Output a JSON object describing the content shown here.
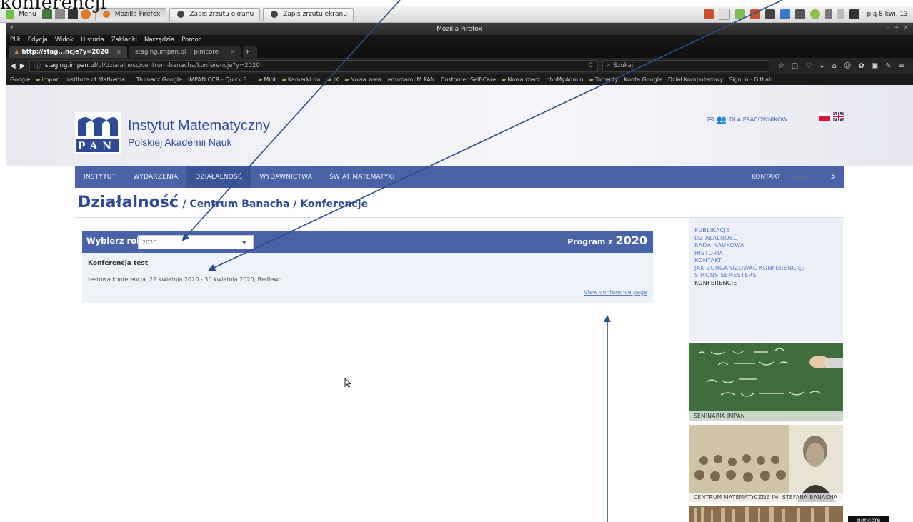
{
  "doc_overlay_text": "konferencji",
  "taskbar": {
    "menu_label": "Menu",
    "tasks": [
      {
        "label": "Mozilla Firefox",
        "active": true
      },
      {
        "label": "Zapis zrzutu ekranu",
        "active": false
      },
      {
        "label": "Zapis zrzutu ekranu",
        "active": false
      }
    ],
    "clock": "pią 8 kwi, 13:"
  },
  "window": {
    "title": "Mozilla Firefox",
    "menubar": [
      "Plik",
      "Edycja",
      "Widok",
      "Historia",
      "Zakładki",
      "Narzędzia",
      "Pomoc"
    ],
    "tabs": [
      {
        "label": "http://stag...ncje?y=2020",
        "active": true
      },
      {
        "label": "staging.impan.pl :: pimcore",
        "active": false
      }
    ],
    "url_host": "staging.impan.pl",
    "url_path": "/pl/dzialalnosc/centrum-banacha/konferencje?y=2020",
    "search_placeholder": "Szukaj",
    "bookmarks": [
      "Google",
      "impan",
      "Institute of Mathema...",
      "Tłumacz Google",
      "IMPAN CCR - Quick S...",
      "Mint",
      "Kamerki dol",
      "JK",
      "Nowa www",
      "eduroam IM PAN",
      "Customer Self-Care",
      "Nowa rzecz",
      "phpMyAdmin",
      "Torrenty",
      "Konta Google",
      "Dział Komputerowy",
      "Sign in · GitLab"
    ]
  },
  "site": {
    "logo_line1": "Instytut Matematyczny",
    "logo_line2": "Polskiej Akademii Nauk",
    "logo_letters": "PAN",
    "staff_link": "DLA PRACOWNIKÓW",
    "nav": [
      "INSTYTUT",
      "WYDARZENIA",
      "DZIAŁALNOŚĆ",
      "WYDAWNICTWA",
      "ŚWIAT MATEMATYKI"
    ],
    "nav_active_index": 2,
    "contact": "KONTAKT",
    "search_placeholder": "szukaj...",
    "breadcrumb_main": "Działalność",
    "breadcrumb_rest": "/ Centrum Banacha / Konferencje",
    "year_label": "Wybierz rok",
    "year_selected": "2020",
    "program_label": "Program z",
    "program_year": "2020",
    "conference": {
      "title": "Konferencja test",
      "description": "testowa konferencja, 22 kwietnia 2020 - 30 kwietnia 2020, Będlewo",
      "link": "View conference page"
    },
    "sidebar": [
      "PUBLIKACJE",
      "DZIAŁALNOŚĆ",
      "RADA NAUKOWA",
      "HISTORIA",
      "KONTAKT",
      "JAK ZORGANIZOWAĆ KONFERENCJĘ?",
      "SIMONS SEMESTERS",
      "KONFERENCJE"
    ],
    "sidebar_current_index": 7,
    "card_seminars": "SEMINARIA IMPAN",
    "card_banach": "CENTRUM MATEMATYCZNE IM. STEFANA BANACHA",
    "pimcore_badge": "pimcore"
  },
  "colors": {
    "brand_blue": "#4a63a8",
    "brand_dark": "#2f4a94",
    "link_blue": "#5b79c4",
    "panel_bg": "#eef1f8",
    "arrow": "#2b4f88"
  }
}
